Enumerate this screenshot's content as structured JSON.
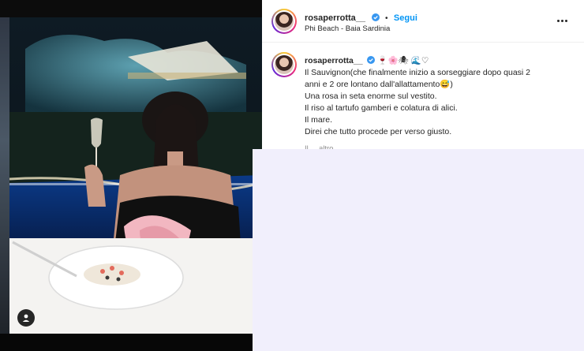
{
  "post": {
    "username": "rosaperrotta__",
    "follow_label": "Segui",
    "separator": "•",
    "location": "Phi Beach - Baia Sardinia",
    "more_label": "More options"
  },
  "caption": {
    "username": "rosaperrotta__",
    "emojis": "🍷🌸🕷 🌊♡",
    "lines": [
      "Il Sauvignon(che finalmente inizio a sorseggiare dopo quasi 2",
      "anni e 2 ore lontano dall'allattamento😅)",
      "Una rosa in seta enorme sul vestito.",
      "Il riso al tartufo gamberi e colatura di alici.",
      "Il mare.",
      "Direi che tutto procede per verso giusto."
    ],
    "truncated_line": "Il ... altro"
  },
  "colors": {
    "accent": "#0095f6",
    "text": "#262626",
    "overlay": "#f1effc"
  },
  "icons": {
    "verified": "verified-badge-icon",
    "user_tag": "user-icon",
    "more": "three-dots-icon"
  }
}
